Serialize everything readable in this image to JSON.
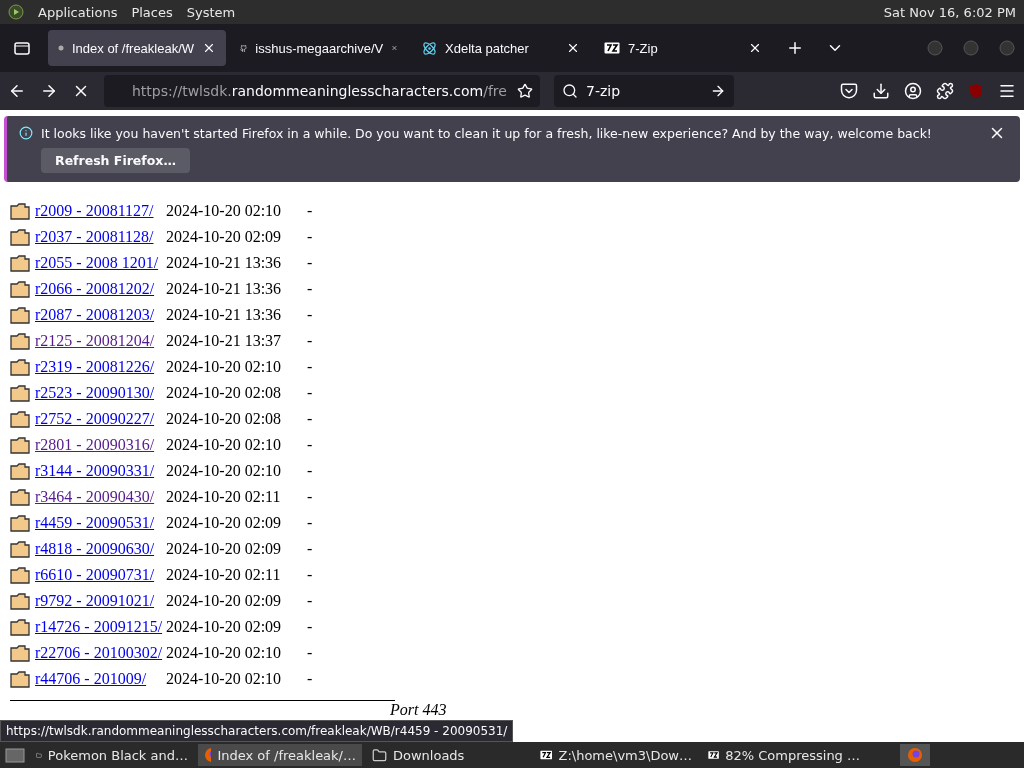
{
  "top_panel": {
    "menus": [
      "Applications",
      "Places",
      "System"
    ],
    "clock": "Sat Nov 16,  6:02 PM"
  },
  "tabs": [
    {
      "title": "Index of /freakleak/W",
      "selected": true
    },
    {
      "title": "isshus-megaarchive/V",
      "selected": false
    },
    {
      "title": "Xdelta patcher",
      "selected": false
    },
    {
      "title": "7-Zip",
      "selected": false
    }
  ],
  "nav": {
    "url_dim": "https://twlsdk.",
    "url_domain": "randommeaninglesscharacters.com",
    "url_rest": "/fre",
    "search": "7-zip",
    "loading": true
  },
  "notification": {
    "message": "It looks like you haven't started Firefox in a while. Do you want to clean it up for a fresh, like-new experience? And by the way, welcome back!",
    "button": "Refresh Firefox…"
  },
  "listing": [
    {
      "name": "r2009 - 20081127/",
      "modified": "2024-10-20 02:10",
      "size": "-",
      "visited": false
    },
    {
      "name": "r2037 - 20081128/",
      "modified": "2024-10-20 02:09",
      "size": "-",
      "visited": false
    },
    {
      "name": "r2055 - 2008 1201/",
      "modified": "2024-10-21 13:36",
      "size": "-",
      "visited": false
    },
    {
      "name": "r2066 - 20081202/",
      "modified": "2024-10-21 13:36",
      "size": "-",
      "visited": false
    },
    {
      "name": "r2087 - 20081203/",
      "modified": "2024-10-21 13:36",
      "size": "-",
      "visited": false
    },
    {
      "name": "r2125 - 20081204/",
      "modified": "2024-10-21 13:37",
      "size": "-",
      "visited": true
    },
    {
      "name": "r2319 - 20081226/",
      "modified": "2024-10-20 02:10",
      "size": "-",
      "visited": false
    },
    {
      "name": "r2523 - 20090130/",
      "modified": "2024-10-20 02:08",
      "size": "-",
      "visited": false
    },
    {
      "name": "r2752 - 20090227/",
      "modified": "2024-10-20 02:08",
      "size": "-",
      "visited": false
    },
    {
      "name": "r2801 - 20090316/",
      "modified": "2024-10-20 02:10",
      "size": "-",
      "visited": true
    },
    {
      "name": "r3144 - 20090331/",
      "modified": "2024-10-20 02:10",
      "size": "-",
      "visited": false
    },
    {
      "name": "r3464 - 20090430/",
      "modified": "2024-10-20 02:11",
      "size": "-",
      "visited": true
    },
    {
      "name": "r4459 - 20090531/",
      "modified": "2024-10-20 02:09",
      "size": "-",
      "visited": false
    },
    {
      "name": "r4818 - 20090630/",
      "modified": "2024-10-20 02:09",
      "size": "-",
      "visited": false
    },
    {
      "name": "r6610 - 20090731/",
      "modified": "2024-10-20 02:11",
      "size": "-",
      "visited": false
    },
    {
      "name": "r9792 - 20091021/",
      "modified": "2024-10-20 02:09",
      "size": "-",
      "visited": false
    },
    {
      "name": "r14726 - 20091215/",
      "modified": "2024-10-20 02:09",
      "size": "-",
      "visited": false
    },
    {
      "name": "r22706 - 20100302/",
      "modified": "2024-10-20 02:10",
      "size": "-",
      "visited": false
    },
    {
      "name": "r44706 - 201009/",
      "modified": "2024-10-20 02:10",
      "size": "-",
      "visited": false
    }
  ],
  "footer_tail": "Port 443",
  "status_url": "https://twlsdk.randommeaninglesscharacters.com/freakleak/WB/r4459 - 20090531/",
  "taskbar": [
    {
      "title": "Pokemon Black and…",
      "selected": false
    },
    {
      "title": "Index of /freakleak/…",
      "selected": true
    },
    {
      "title": "Downloads",
      "selected": false
    },
    {
      "title": "Z:\\home\\vm3\\Dow…",
      "selected": false
    },
    {
      "title": "82% Compressing …",
      "selected": false
    }
  ]
}
